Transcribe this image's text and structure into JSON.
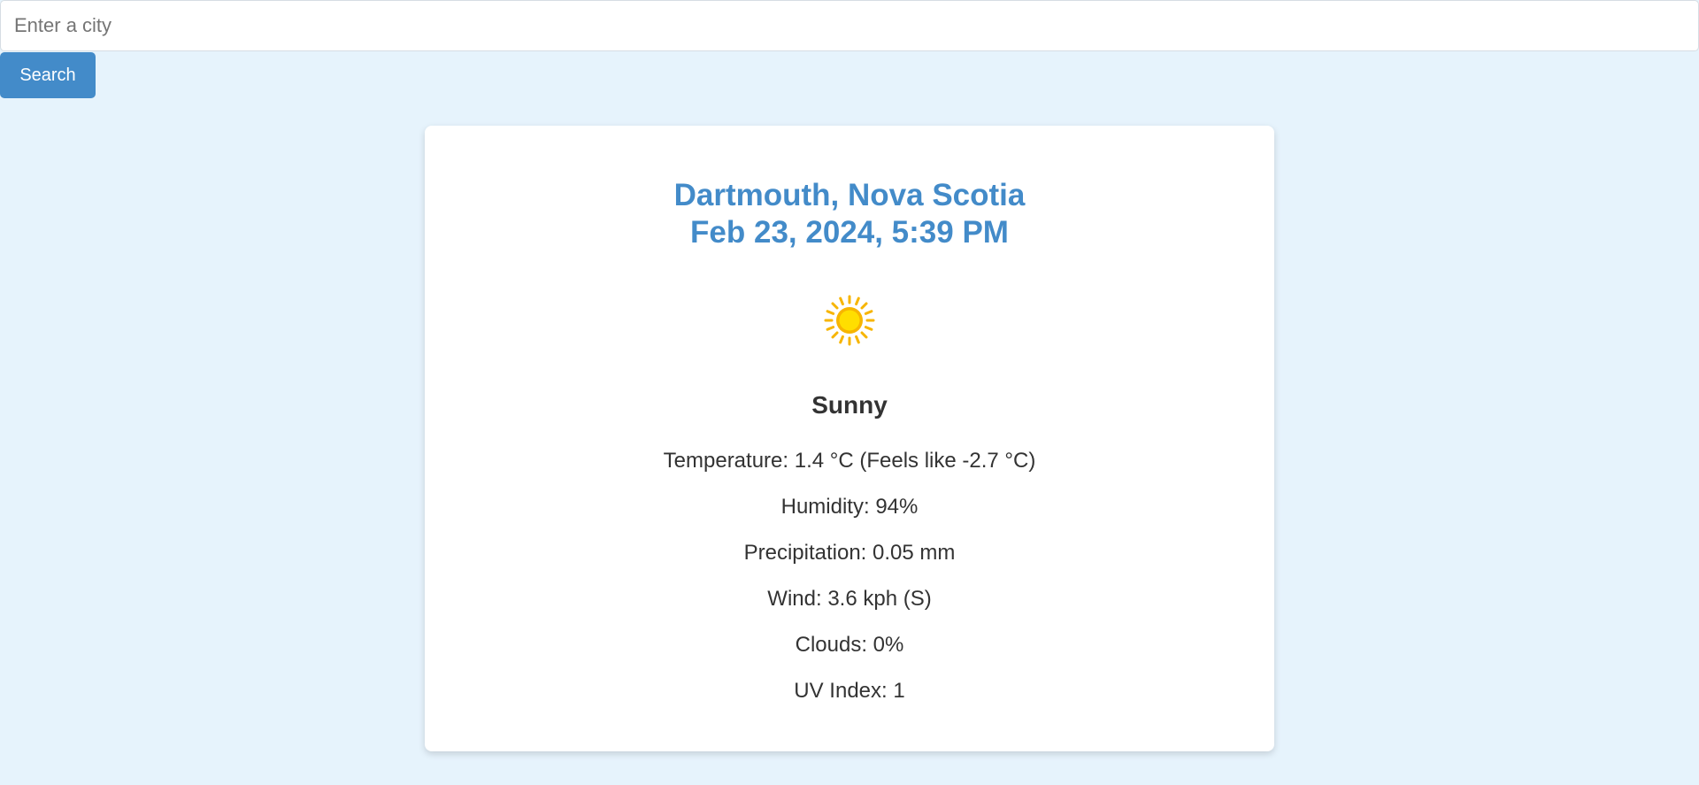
{
  "search": {
    "placeholder": "Enter a city",
    "value": "",
    "button_label": "Search"
  },
  "weather": {
    "location": "Dartmouth, Nova Scotia",
    "datetime": "Feb 23, 2024, 5:39 PM",
    "icon": "sun-icon",
    "condition": "Sunny",
    "details": {
      "temperature": "Temperature: 1.4 °C (Feels like -2.7 °C)",
      "humidity": "Humidity: 94%",
      "precipitation": "Precipitation: 0.05 mm",
      "wind": "Wind: 3.6 kph (S)",
      "clouds": "Clouds: 0%",
      "uv_index": "UV Index: 1"
    }
  },
  "colors": {
    "background": "#e6f3fc",
    "accent": "#438bc9",
    "card": "#ffffff",
    "sun": "#ffcc00",
    "sun_rays": "#f7b500"
  }
}
